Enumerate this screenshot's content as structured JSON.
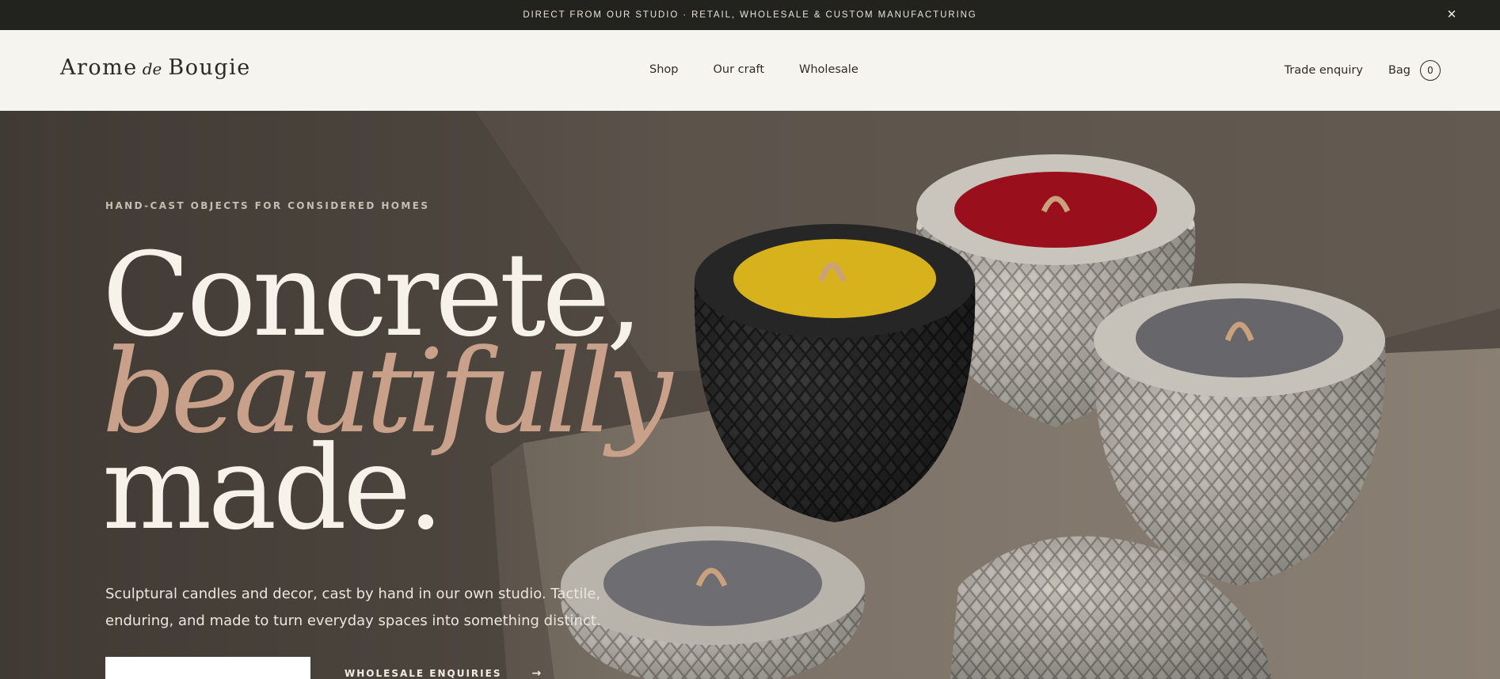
{
  "announcement": {
    "text": "DIRECT FROM OUR STUDIO · RETAIL, WHOLESALE & CUSTOM MANUFACTURING",
    "close_icon": "close-icon",
    "close_glyph": "✕"
  },
  "header": {
    "logo": {
      "part1": "Arome",
      "part2": "de",
      "part3": "Bougie"
    },
    "nav": [
      {
        "label": "Shop"
      },
      {
        "label": "Our craft"
      },
      {
        "label": "Wholesale"
      }
    ],
    "trade_enquiry": "Trade enquiry",
    "bag_label": "Bag",
    "bag_count": "0"
  },
  "hero": {
    "eyebrow": "HAND-CAST OBJECTS FOR CONSIDERED HOMES",
    "headline": {
      "line1": "Concrete,",
      "line2": "beautifully",
      "line3": "made."
    },
    "subcopy": "Sculptural candles and decor, cast by hand in our own studio. Tactile, enduring, and made to turn everyday spaces into something distinct.",
    "secondary_cta": "WHOLESALE ENQUIRIES",
    "secondary_cta_arrow": "→",
    "colors": {
      "accent": "#c9a08a",
      "candle_yellow": "#d8b21d",
      "candle_red": "#9a0f1c",
      "candle_grey": "#66666b",
      "vessel_dark": "#2c2c2c",
      "vessel_light": "#bab5ad"
    }
  }
}
